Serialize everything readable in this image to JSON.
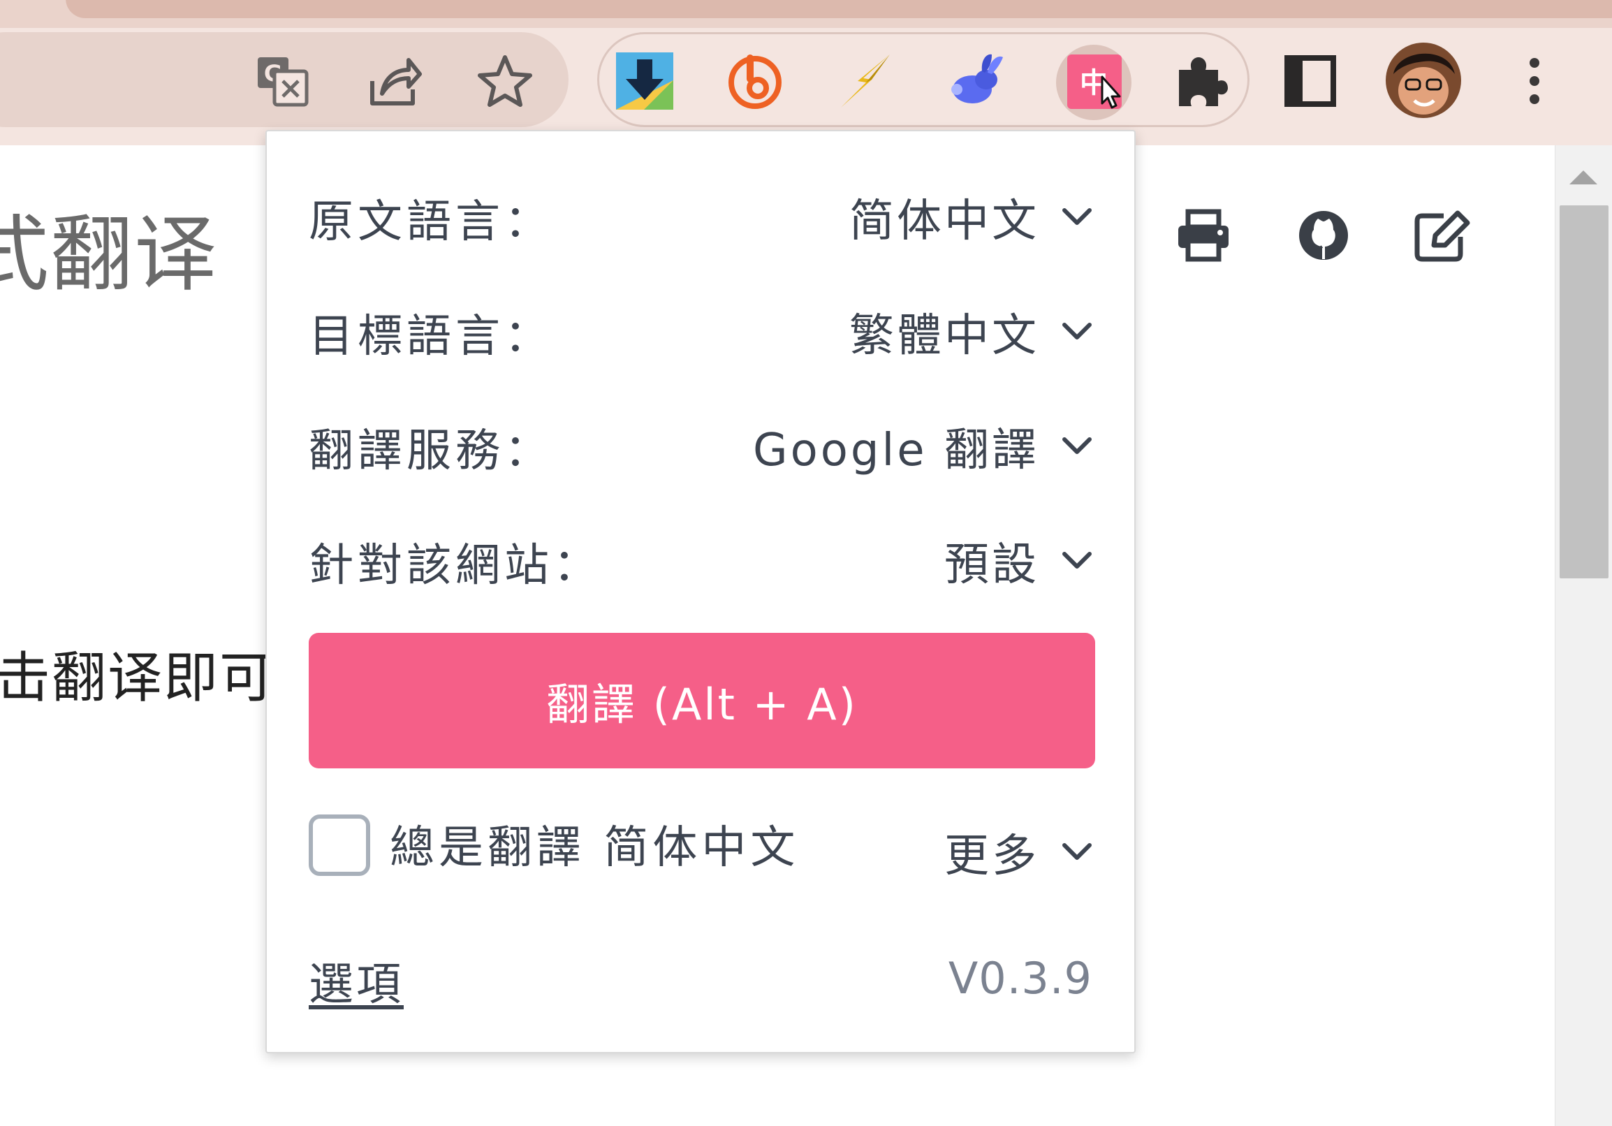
{
  "colors": {
    "accent": "#f55f88",
    "popup_text": "#3d4450",
    "version_text": "#7b8290",
    "toolbar_bg": "#f4e5e0",
    "tab_strip_bg": "#ead3cb",
    "omnibox_bg": "#e7d3cc"
  },
  "toolbar": {
    "icons": [
      "translate-icon",
      "share-icon",
      "star-icon",
      "download-extension-icon",
      "bitly-extension-icon",
      "lightning-extension-icon",
      "rabbit-extension-icon",
      "immersive-translate-extension-icon",
      "extensions-puzzle-icon",
      "side-panel-icon",
      "profile-avatar",
      "menu-kebab-icon"
    ]
  },
  "page": {
    "title_fragment": "式翻译",
    "text_fragment": "击翻译即可",
    "tools": [
      "print-icon",
      "github-icon",
      "edit-icon"
    ]
  },
  "popup": {
    "rows": [
      {
        "label": "原文語言：",
        "value": "简体中文"
      },
      {
        "label": "目標語言：",
        "value": "繁體中文"
      },
      {
        "label": "翻譯服務：",
        "value": "Google 翻譯"
      },
      {
        "label": "針對該網站：",
        "value": "預設"
      }
    ],
    "translate_button": "翻譯 (Alt + A)",
    "always_translate_label": "總是翻譯 简体中文",
    "always_translate_checked": false,
    "more_label": "更多",
    "options_link": "選項",
    "version": "V0.3.9"
  }
}
